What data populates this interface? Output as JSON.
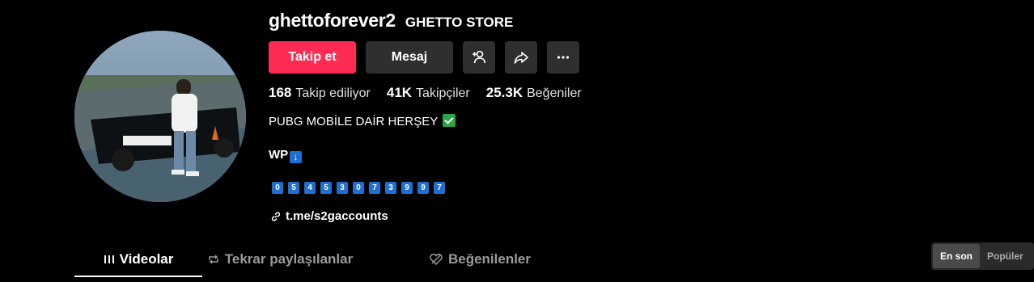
{
  "profile": {
    "username": "ghettoforever2",
    "nickname": "GHETTO STORE",
    "avatar_alt": ""
  },
  "actions": {
    "follow_label": "Takip et",
    "message_label": "Mesaj",
    "add_friend_icon": "add-user-icon",
    "share_icon": "share-icon",
    "more_icon": "more-icon"
  },
  "stats": {
    "following_count": "168",
    "following_label": "Takip ediliyor",
    "followers_count": "41K",
    "followers_label": "Takipçiler",
    "likes_count": "25.3K",
    "likes_label": "Beğeniler"
  },
  "bio": {
    "line1": "PUBG MOBİLE DAİR HERŞEY",
    "line2": "WP",
    "digits": [
      "0",
      "5",
      "4",
      "5",
      "3",
      "0",
      "7",
      "3",
      "9",
      "9",
      "7"
    ],
    "link": "t.me/s2gaccounts"
  },
  "tabs": {
    "videos": "Videolar",
    "reposts": "Tekrar paylaşılanlar",
    "liked": "Beğenilenler"
  },
  "sort": {
    "latest": "En son",
    "popular": "Popüler"
  },
  "colors": {
    "accent": "#fe2c55",
    "button_bg": "#2f2f2f",
    "emoji_blue": "#1f6fd1",
    "check_green": "#2aa745"
  }
}
